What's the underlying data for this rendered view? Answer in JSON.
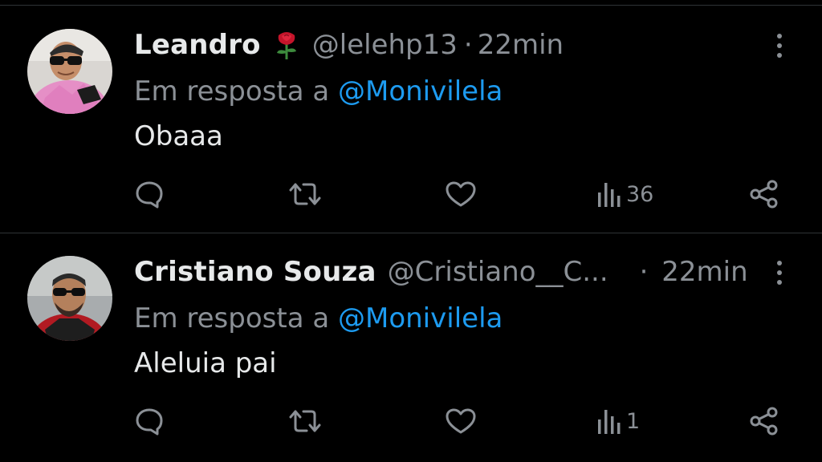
{
  "replies": [
    {
      "name": "Leandro",
      "emoji": "rose",
      "handle": "@lelehp13",
      "separator": "·",
      "time": "22min",
      "reply_prefix": "Em resposta a",
      "reply_to": "@Monivilela",
      "text": "Obaaa",
      "views": "36"
    },
    {
      "name": "Cristiano Souza",
      "handle": "@Cristiano__C...",
      "separator": "·",
      "time": "22min",
      "reply_prefix": "Em resposta a",
      "reply_to": "@Monivilela",
      "text": "Aleluia pai",
      "views": "1"
    }
  ],
  "colors": {
    "background": "#000000",
    "primary_text": "#e7e9ea",
    "secondary_text": "#8b9096",
    "link": "#1d9bf0",
    "divider": "#2f3336"
  },
  "icons": {
    "reply": "comment-icon",
    "retweet": "retweet-icon",
    "like": "heart-icon",
    "views": "views-chart-icon",
    "share": "share-icon",
    "more": "more-vertical-icon"
  }
}
